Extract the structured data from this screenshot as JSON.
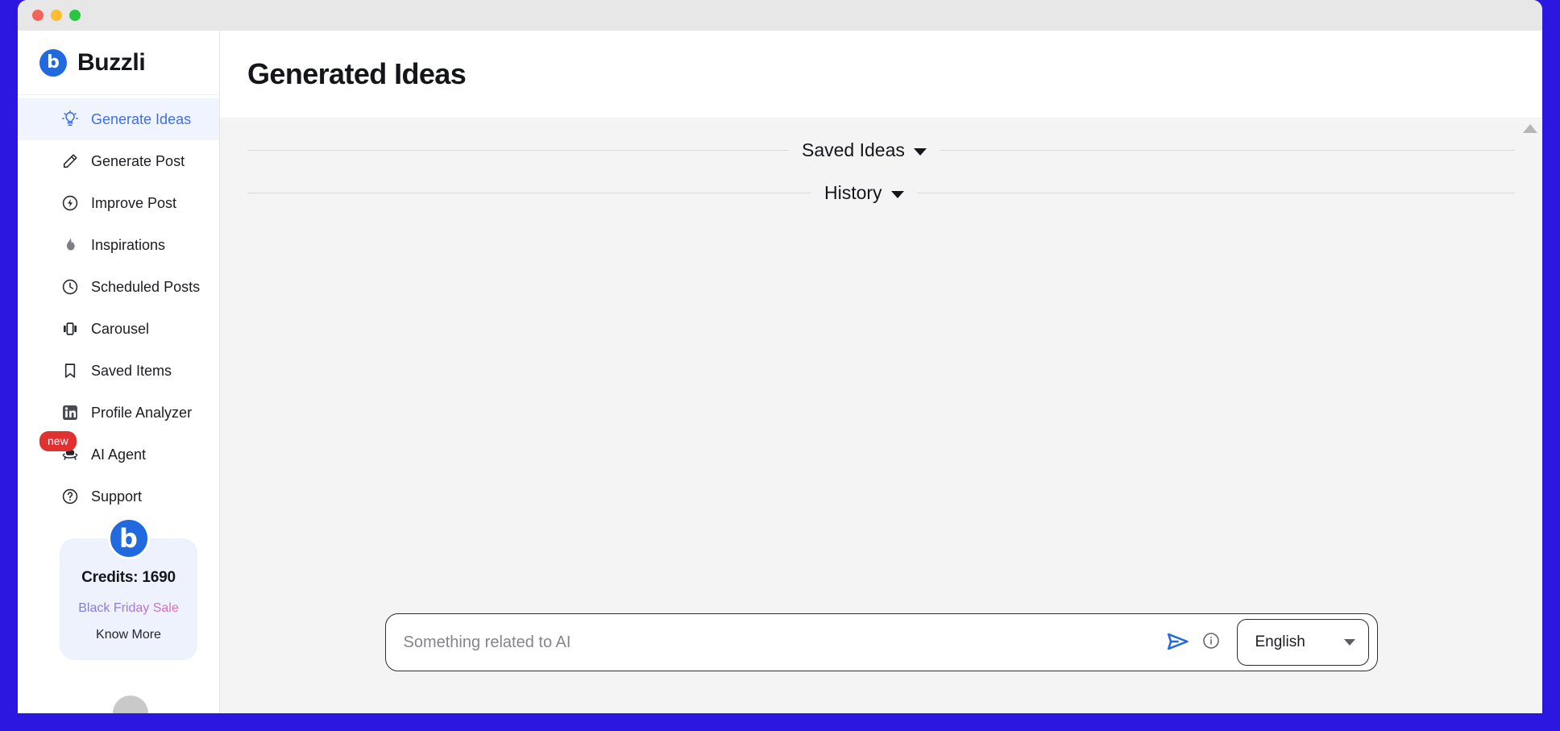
{
  "window": {
    "traffic_lights": [
      "close",
      "minimize",
      "maximize"
    ],
    "accent_border_color": "#2B17E0"
  },
  "sidebar": {
    "brand": {
      "name": "Buzzli",
      "logo_icon": "buzzli-logo-icon",
      "logo_glyph": "b",
      "logo_color": "#2069DF"
    },
    "items": [
      {
        "label": "Generate Ideas",
        "icon": "lightbulb-icon",
        "active": true,
        "badge": null
      },
      {
        "label": "Generate Post",
        "icon": "pencil-icon",
        "active": false,
        "badge": null
      },
      {
        "label": "Improve Post",
        "icon": "bolt-circle-icon",
        "active": false,
        "badge": null
      },
      {
        "label": "Inspirations",
        "icon": "flame-icon",
        "active": false,
        "badge": null
      },
      {
        "label": "Scheduled Posts",
        "icon": "clock-icon",
        "active": false,
        "badge": null
      },
      {
        "label": "Carousel",
        "icon": "carousel-icon",
        "active": false,
        "badge": null
      },
      {
        "label": "Saved Items",
        "icon": "bookmark-icon",
        "active": false,
        "badge": null
      },
      {
        "label": "Profile Analyzer",
        "icon": "linkedin-icon",
        "active": false,
        "badge": null
      },
      {
        "label": "AI Agent",
        "icon": "ai-agent-robot-icon",
        "active": false,
        "badge": "new"
      },
      {
        "label": "Support",
        "icon": "question-circle-icon",
        "active": false,
        "badge": null
      }
    ],
    "credits_card": {
      "avatar_icon": "buzzli-avatar-icon",
      "avatar_glyph": "b",
      "credits_label": "Credits: 1690",
      "sale_label": "Black Friday Sale",
      "know_more_label": "Know More",
      "sale_gradient_from": "#6F7FE8",
      "sale_gradient_to": "#F06CB0",
      "card_bg": "#EDF2FC"
    },
    "active_item_bg": "#EFF4FE",
    "active_item_color": "#3F6FE3"
  },
  "main": {
    "page_title": "Generated Ideas",
    "sections": [
      {
        "label": "Saved Ideas",
        "caret_icon": "chevron-down-icon",
        "expanded": false
      },
      {
        "label": "History",
        "caret_icon": "chevron-down-icon",
        "expanded": false
      }
    ],
    "scroll_arrow_icon": "scroll-up-arrow-icon"
  },
  "composer": {
    "input_value": "",
    "input_placeholder": "Something related to AI",
    "send_icon": "send-paper-plane-icon",
    "send_icon_color": "#2069DF",
    "info_icon": "info-circle-icon",
    "language": {
      "selected": "English",
      "caret_icon": "chevron-down-icon"
    }
  }
}
